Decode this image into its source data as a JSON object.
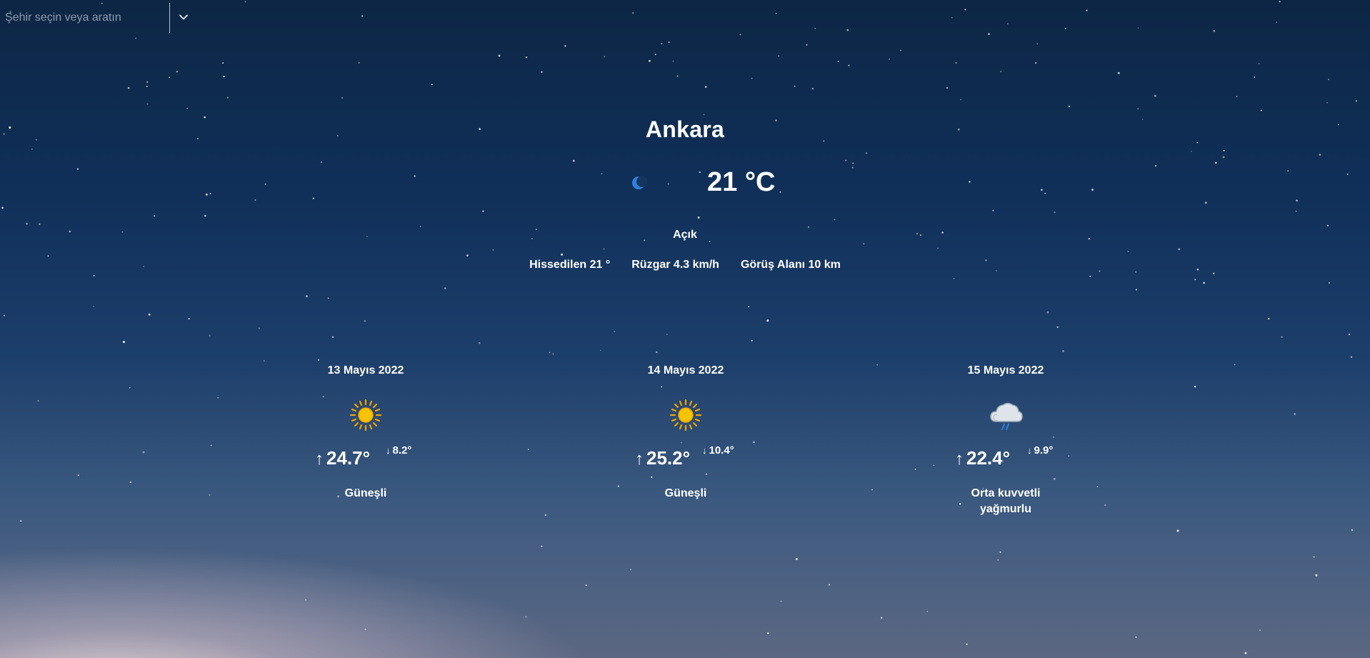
{
  "search": {
    "placeholder": "Şehir seçin veya aratın",
    "chevron_icon": "chevron-down-icon"
  },
  "current": {
    "city": "Ankara",
    "icon": "moon-icon",
    "temperature": "21 °C",
    "condition": "Açık",
    "feels_like": "Hissedilen 21 °",
    "wind": "Rüzgar 4.3 km/h",
    "visibility": "Görüş Alanı 10 km"
  },
  "forecast": [
    {
      "date": "13 Mayıs 2022",
      "icon": "sun-icon",
      "high": "24.7°",
      "low": "8.2°",
      "description": "Güneşli"
    },
    {
      "date": "14 Mayıs 2022",
      "icon": "sun-icon",
      "high": "25.2°",
      "low": "10.4°",
      "description": "Güneşli"
    },
    {
      "date": "15 Mayıs 2022",
      "icon": "rain-cloud-icon",
      "high": "22.4°",
      "low": "9.9°",
      "description": "Orta kuvvetli yağmurlu"
    }
  ],
  "colors": {
    "sky_top": "#0d2645",
    "sky_bottom": "#5b6782",
    "sun": "#f5b301",
    "moon": "#2f7fe0",
    "text": "#ffffff"
  }
}
